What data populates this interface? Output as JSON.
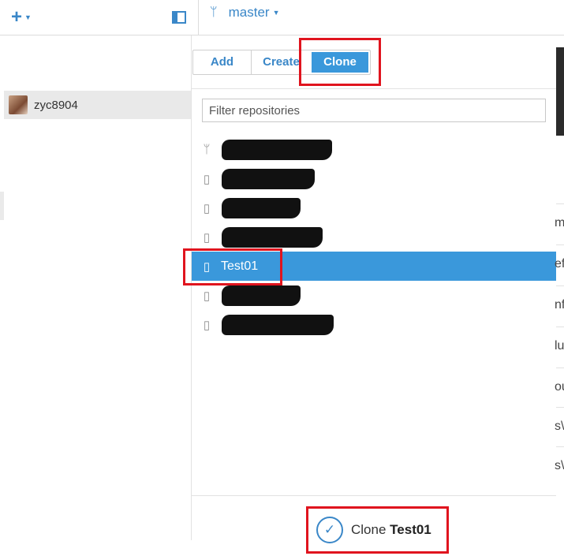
{
  "toolbar": {
    "add_icon": "plus-icon",
    "branch_icon": "branch-icon",
    "branch_name": "master"
  },
  "sidebar": {
    "account_name": "zyc8904"
  },
  "popover": {
    "tabs": [
      {
        "label": "Add",
        "active": false
      },
      {
        "label": "Create",
        "active": false
      },
      {
        "label": "Clone",
        "active": true
      }
    ],
    "filter_placeholder": "Filter repositories",
    "repositories": [
      {
        "name": "",
        "icon": "fork-icon",
        "redacted": true
      },
      {
        "name": "",
        "icon": "repo-icon",
        "redacted": true
      },
      {
        "name": "",
        "icon": "repo-icon",
        "redacted": true
      },
      {
        "name": "",
        "icon": "repo-icon",
        "redacted": true
      },
      {
        "name": "Test01",
        "icon": "repo-icon",
        "redacted": false,
        "selected": true
      },
      {
        "name": "",
        "icon": "repo-icon",
        "redacted": true
      },
      {
        "name": "",
        "icon": "repo-icon",
        "redacted": true
      }
    ],
    "clone_button_prefix": "Clone",
    "clone_button_repo": "Test01"
  },
  "right_edge_text": [
    "m",
    "ef",
    "nf",
    "lu",
    "ou",
    "s\\",
    "s\\"
  ],
  "colors": {
    "accent": "#3a87c8",
    "selected": "#3a98db",
    "highlight": "#e0141e"
  }
}
